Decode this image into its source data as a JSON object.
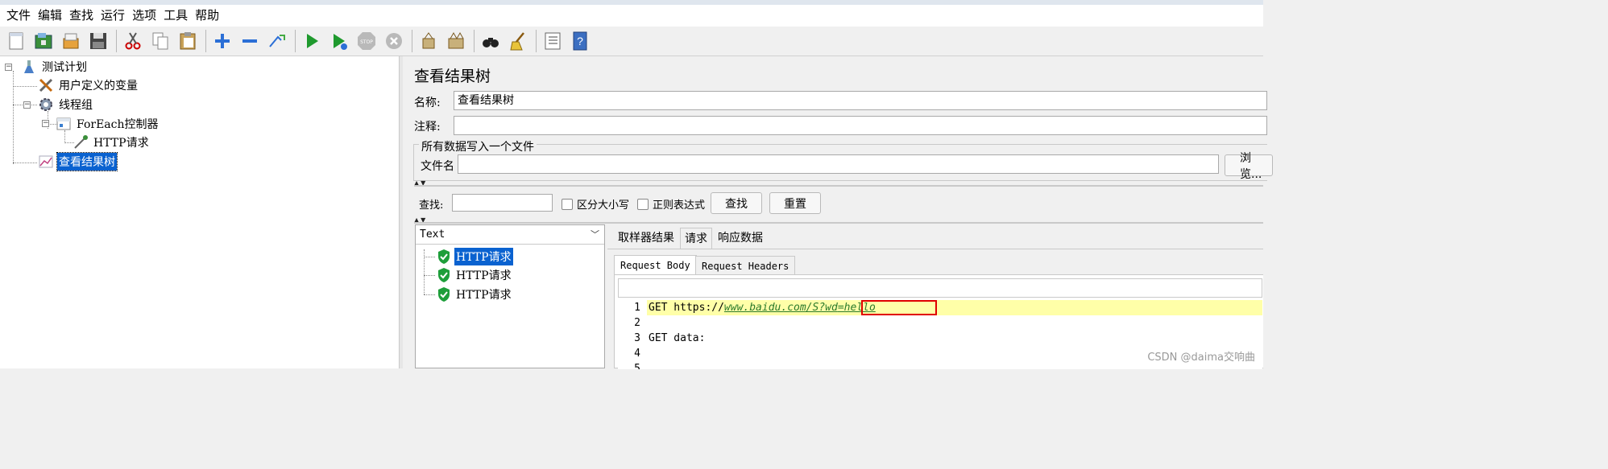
{
  "menu": [
    "文件",
    "编辑",
    "查找",
    "运行",
    "选项",
    "工具",
    "帮助"
  ],
  "toolbar_icons": [
    "new-icon",
    "templates-icon",
    "open-icon",
    "save-icon",
    "cut-icon",
    "copy-icon",
    "paste-icon",
    "expand-icon",
    "collapse-icon",
    "toggle-icon",
    "start-icon",
    "start-no-pause-icon",
    "stop-icon",
    "shutdown-icon",
    "clear-icon",
    "clear-all-icon",
    "search-binoculars-icon",
    "reset-search-broom-icon",
    "function-helper-icon",
    "help-icon"
  ],
  "tree": {
    "items": [
      {
        "label": "测试计划",
        "icon": "test-plan-icon"
      },
      {
        "label": "用户定义的变量",
        "icon": "tools-icon"
      },
      {
        "label": "线程组",
        "icon": "gear-icon"
      },
      {
        "label": "ForEach控制器",
        "icon": "controller-icon"
      },
      {
        "label": "HTTP请求",
        "icon": "pipette-icon"
      },
      {
        "label": "查看结果树",
        "icon": "graph-icon",
        "selected": true
      }
    ]
  },
  "panel": {
    "title": "查看结果树",
    "name_label": "名称:",
    "name_value": "查看结果树",
    "comment_label": "注释:",
    "comment_value": "",
    "file_group_legend": "所有数据写入一个文件",
    "filename_label": "文件名",
    "filename_value": "",
    "browse_label": "浏览..."
  },
  "search": {
    "label": "查找:",
    "value": "",
    "case_sensitive_label": "区分大小写",
    "regex_label": "正则表达式",
    "find_button": "查找",
    "reset_button": "重置"
  },
  "results": {
    "renderer": "Text",
    "items": [
      {
        "label": "HTTP请求",
        "status": "success",
        "selected": true
      },
      {
        "label": "HTTP请求",
        "status": "success",
        "selected": false
      },
      {
        "label": "HTTP请求",
        "status": "success",
        "selected": false
      }
    ]
  },
  "detail_tabs": [
    "取样器结果",
    "请求",
    "响应数据"
  ],
  "active_detail_tab": "请求",
  "request_subtabs": [
    "Request Body",
    "Request Headers"
  ],
  "editor": {
    "lines": [
      {
        "n": "1",
        "prefix": "GET https://",
        "link": "www.baidu.com/S?wd",
        "tail": "=hello"
      },
      {
        "n": "2",
        "text": ""
      },
      {
        "n": "3",
        "text": "GET data:"
      },
      {
        "n": "4",
        "text": ""
      },
      {
        "n": "5",
        "text": ""
      }
    ]
  },
  "watermark": "CSDN @daima交响曲",
  "colors": {
    "selection": "#0a62d0",
    "highlight_line": "#ffffa8",
    "annotation_box": "#e00000",
    "link": "#2b7a2b",
    "success": "#1e9e3a"
  }
}
